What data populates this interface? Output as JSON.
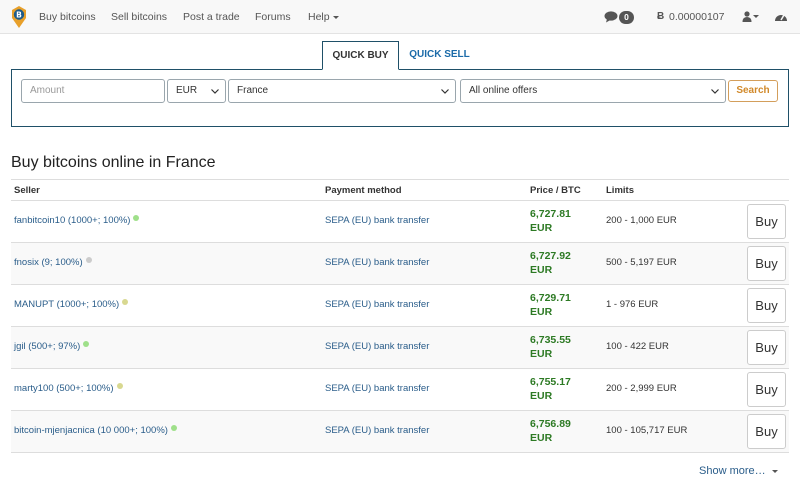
{
  "nav": {
    "items": [
      "Buy bitcoins",
      "Sell bitcoins",
      "Post a trade",
      "Forums",
      "Help"
    ],
    "message_count": "0",
    "btc_symbol": "Ƀ",
    "balance": "0.00000107"
  },
  "quick": {
    "tab_buy": "QUICK BUY",
    "tab_sell": "QUICK SELL",
    "amount_placeholder": "Amount",
    "currency": "EUR",
    "country": "France",
    "offers": "All online offers",
    "search_label": "Search"
  },
  "heading": "Buy bitcoins online in France",
  "table": {
    "headers": {
      "seller": "Seller",
      "payment": "Payment method",
      "price": "Price / BTC",
      "limits": "Limits"
    },
    "buy_label": "Buy",
    "rows": [
      {
        "seller": "fanbitcoin10 (1000+; 100%)",
        "status_color": "#9fe08a",
        "payment": "SEPA (EU) bank transfer",
        "price": "6,727.81",
        "currency": "EUR",
        "limits": "200 - 1,000 EUR"
      },
      {
        "seller": "fnosix (9; 100%)",
        "status_color": "#cccccc",
        "payment": "SEPA (EU) bank transfer",
        "price": "6,727.92",
        "currency": "EUR",
        "limits": "500 - 5,197 EUR"
      },
      {
        "seller": "MANUPT (1000+; 100%)",
        "status_color": "#d8d890",
        "payment": "SEPA (EU) bank transfer",
        "price": "6,729.71",
        "currency": "EUR",
        "limits": "1 - 976 EUR"
      },
      {
        "seller": "jgil (500+; 97%)",
        "status_color": "#9fe08a",
        "payment": "SEPA (EU) bank transfer",
        "price": "6,735.55",
        "currency": "EUR",
        "limits": "100 - 422 EUR"
      },
      {
        "seller": "marty100 (500+; 100%)",
        "status_color": "#d8d890",
        "payment": "SEPA (EU) bank transfer",
        "price": "6,755.17",
        "currency": "EUR",
        "limits": "200 - 2,999 EUR"
      },
      {
        "seller": "bitcoin-mjenjacnica (10 000+; 100%)",
        "status_color": "#9fe08a",
        "payment": "SEPA (EU) bank transfer",
        "price": "6,756.89",
        "currency": "EUR",
        "limits": "100 - 105,717 EUR"
      }
    ]
  },
  "show_more": "Show more…"
}
